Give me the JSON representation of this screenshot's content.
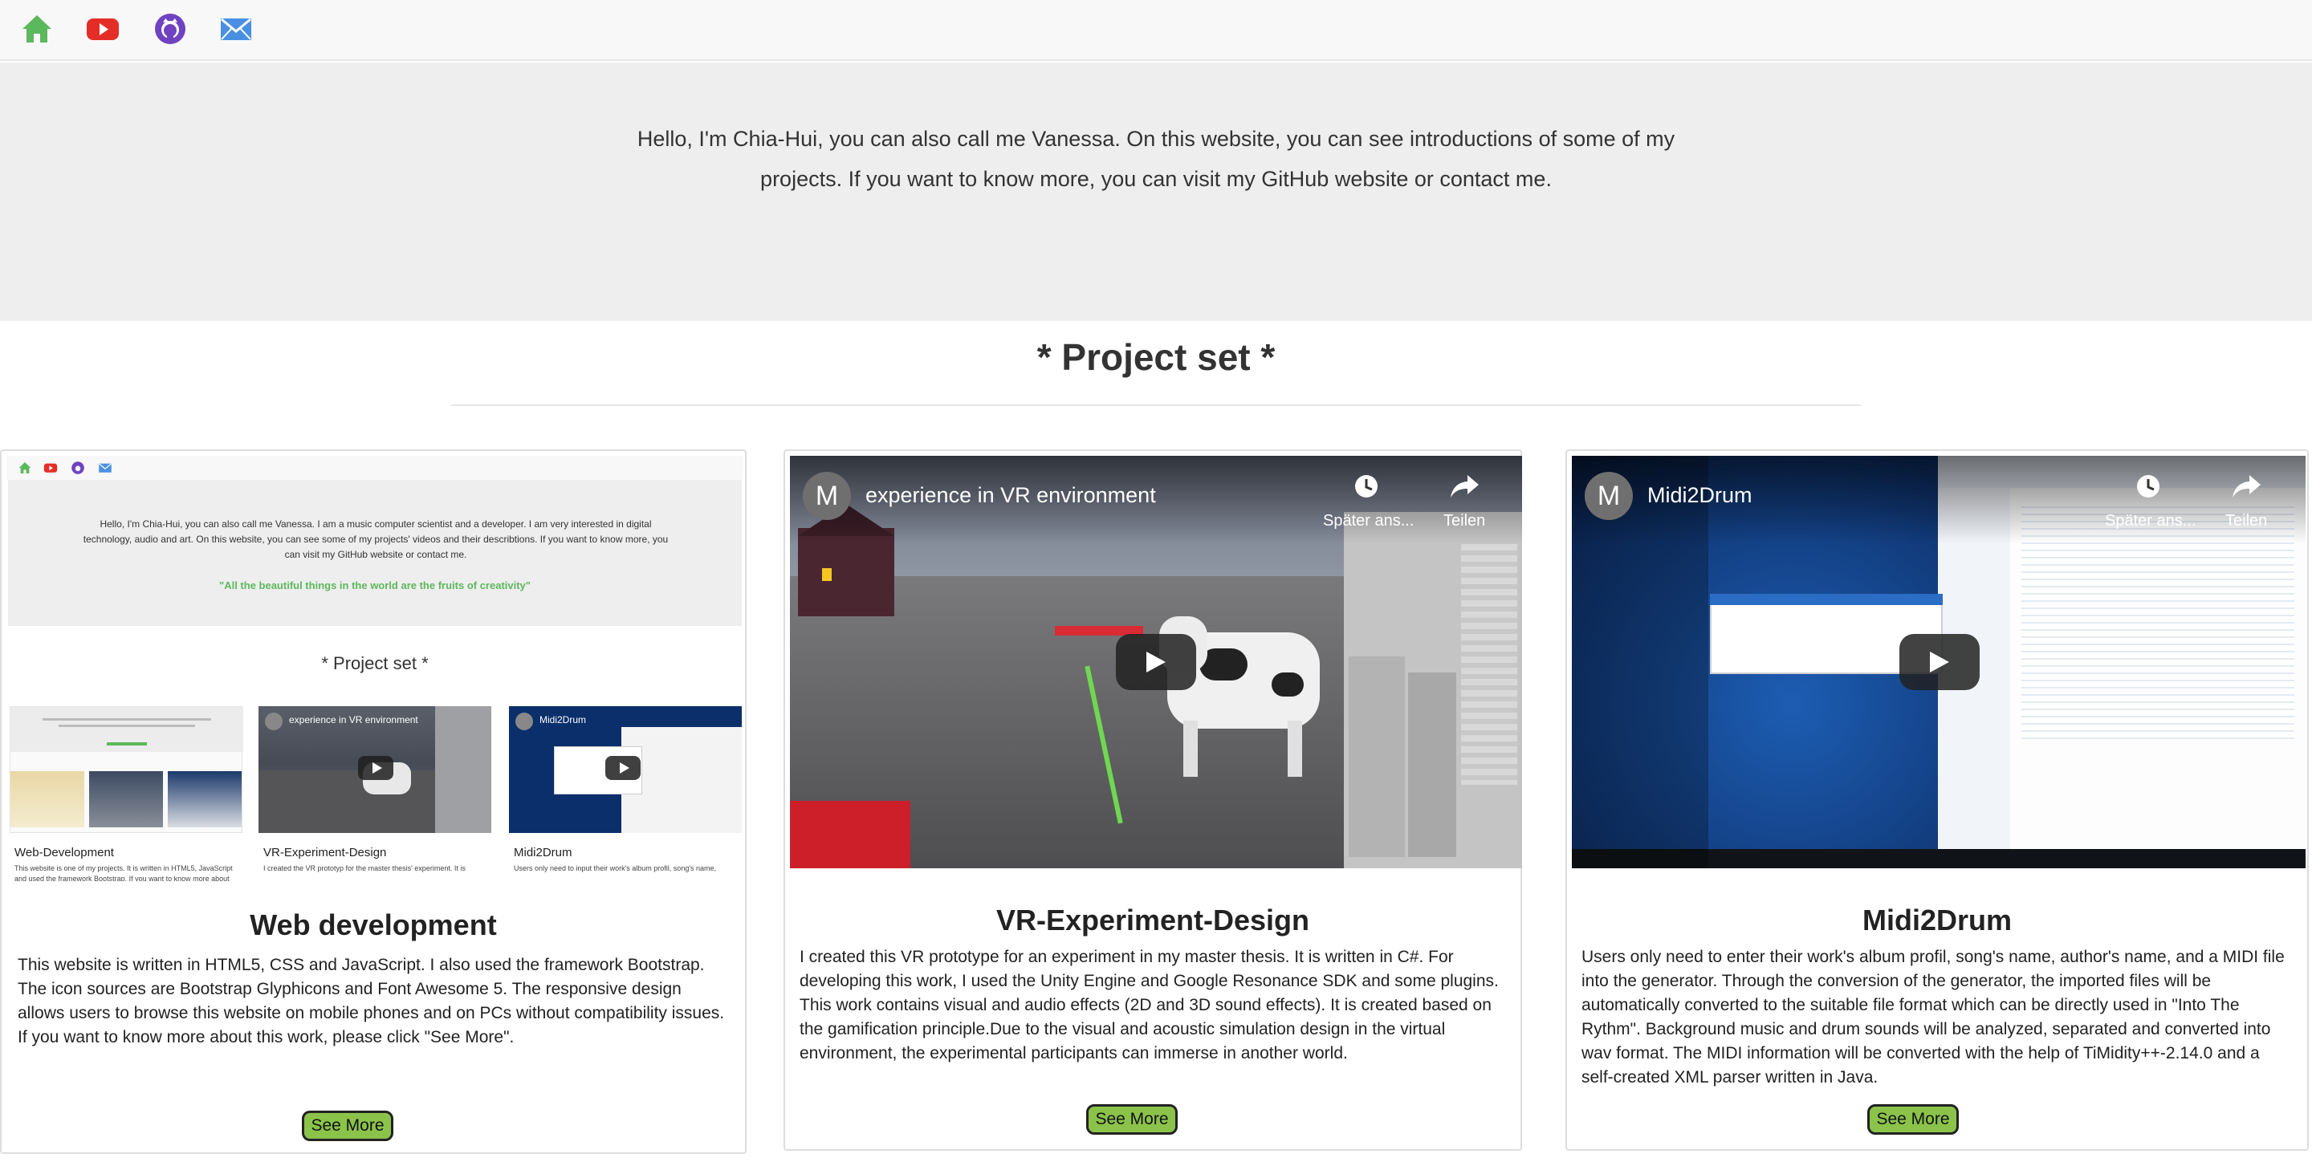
{
  "nav": {
    "icons": [
      "home-icon",
      "youtube-icon",
      "github-icon",
      "mail-icon"
    ],
    "colors": {
      "home": "#5cb85c",
      "youtube": "#e52d27",
      "github": "#6f42c1",
      "mail": "#4a90e2"
    }
  },
  "intro": {
    "text": "Hello, I'm Chia-Hui, you can also call me Vanessa. On this website, you can see introductions of some of my projects. If you want to know more, you can visit my GitHub website or contact me."
  },
  "projects_title": "* Project set *",
  "cards": [
    {
      "title": "Web development",
      "description": "This website is written in HTML5, CSS and JavaScript. I also used the framework Bootstrap. The icon sources are Bootstrap Glyphicons and Font Awesome 5. The responsive design allows users to browse this website on mobile phones and on PCs without compatibility issues. If you want to know more about this work, please click \"See More\".",
      "button": "See More",
      "thumbnail": {
        "intro": "Hello, I'm Chia-Hui, you can also call me Vanessa. I am a music computer scientist and a developer. I am very interested in digital technology, audio and art. On this website, you can see some of my projects' videos and their describtions. If you want to know more, you can visit my GitHub website or contact me.",
        "quote": "\"All the beautiful things in the world are the fruits of creativity\"",
        "title": "* Project set *",
        "cards": [
          {
            "title": "Web-Development",
            "text": "This website is one of my projects. It is written in HTML5, JavaScript and used the framework Bootstrap. If you want to know more about"
          },
          {
            "title": "VR-Experiment-Design",
            "text": "I created the VR prototyp for the master thesis' experiment. It is"
          },
          {
            "title": "Midi2Drum",
            "text": "Users only need to input their work's album profil, song's name,"
          }
        ],
        "video1_title": "experience in VR environment",
        "video2_title": "Midi2Drum"
      }
    },
    {
      "title": "VR-Experiment-Design",
      "description": "I created this VR prototype for an experiment in my master thesis. It is written in C#. For developing this work, I used the Unity Engine and Google Resonance SDK and some plugins. This work contains visual and audio effects (2D and 3D sound effects). It is created based on the gamification principle.Due to the visual and acoustic simulation design in the virtual environment, the experimental participants can immerse in another world.",
      "button": "See More",
      "video": {
        "avatar": "M",
        "title": "experience in VR environment",
        "watch_later": "Später ans...",
        "share": "Teilen"
      }
    },
    {
      "title": "Midi2Drum",
      "description": "Users only need to enter their work's album profil, song's name, author's name, and a MIDI file into the generator. Through the conversion of the generator, the imported files will be automatically converted to the suitable file format which can be directly used in \"Into The Rythm\". Background music and drum sounds will be analyzed, separated and converted into wav format. The MIDI information will be converted with the help of TiMidity++-2.14.0 and a self-created XML parser written in Java.",
      "button": "See More",
      "video": {
        "avatar": "M",
        "title": "Midi2Drum",
        "watch_later": "Später ans...",
        "share": "Teilen"
      }
    }
  ]
}
